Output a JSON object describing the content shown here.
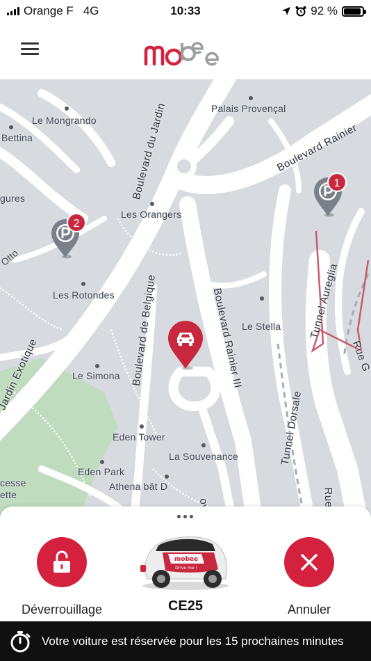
{
  "status_bar": {
    "carrier": "Orange F",
    "network": "4G",
    "time": "10:33",
    "battery": "92 %",
    "battery_level": 0.92,
    "icons": [
      "signal-bars-icon",
      "location-arrow-icon",
      "alarm-clock-icon",
      "battery-icon"
    ]
  },
  "header": {
    "menu_icon": "hamburger-menu-icon",
    "logo_text": "mobee",
    "brand_color": "#d4213d"
  },
  "map": {
    "places": [
      {
        "name": "Le Mongrando"
      },
      {
        "name": "Bettina"
      },
      {
        "name": "gures"
      },
      {
        "name": "Palais Provençal"
      },
      {
        "name": "Les Orangers"
      },
      {
        "name": "Otto"
      },
      {
        "name": "Les Rotondes"
      },
      {
        "name": "Le Stella"
      },
      {
        "name": "Le Simona"
      },
      {
        "name": "Eden Tower"
      },
      {
        "name": "La Souvenance"
      },
      {
        "name": "Eden Park"
      },
      {
        "name": "Athena bât D"
      },
      {
        "name": "cesse"
      },
      {
        "name": "ette"
      }
    ],
    "streets": [
      "Boulevard du Jardin",
      "Boulevard Rainier",
      "Jardin Exotique",
      "Boulevard de Belgique",
      "Boulevard Rainier III",
      "Tunnel Aureglia",
      "Tunnel Dorsale",
      "Rue G",
      "Rue",
      "ovès"
    ],
    "parking_markers": [
      {
        "count": "2",
        "icon": "parking-pin-icon"
      },
      {
        "count": "1",
        "icon": "parking-pin-icon"
      }
    ],
    "car_marker_icon": "car-pin-icon",
    "marker_color": "#c8283d"
  },
  "bottom_sheet": {
    "handle_icon": "more-dots-icon",
    "unlock": {
      "label": "Déverrouillage",
      "icon": "unlock-icon"
    },
    "car": {
      "plate": "CE25",
      "image_caption": "Drive me !",
      "image_label": "mobee"
    },
    "cancel": {
      "label": "Annuler",
      "icon": "close-icon"
    }
  },
  "reservation_banner": {
    "icon": "stopwatch-icon",
    "text": "Votre voiture est réservée pour les 15 prochaines minutes"
  }
}
